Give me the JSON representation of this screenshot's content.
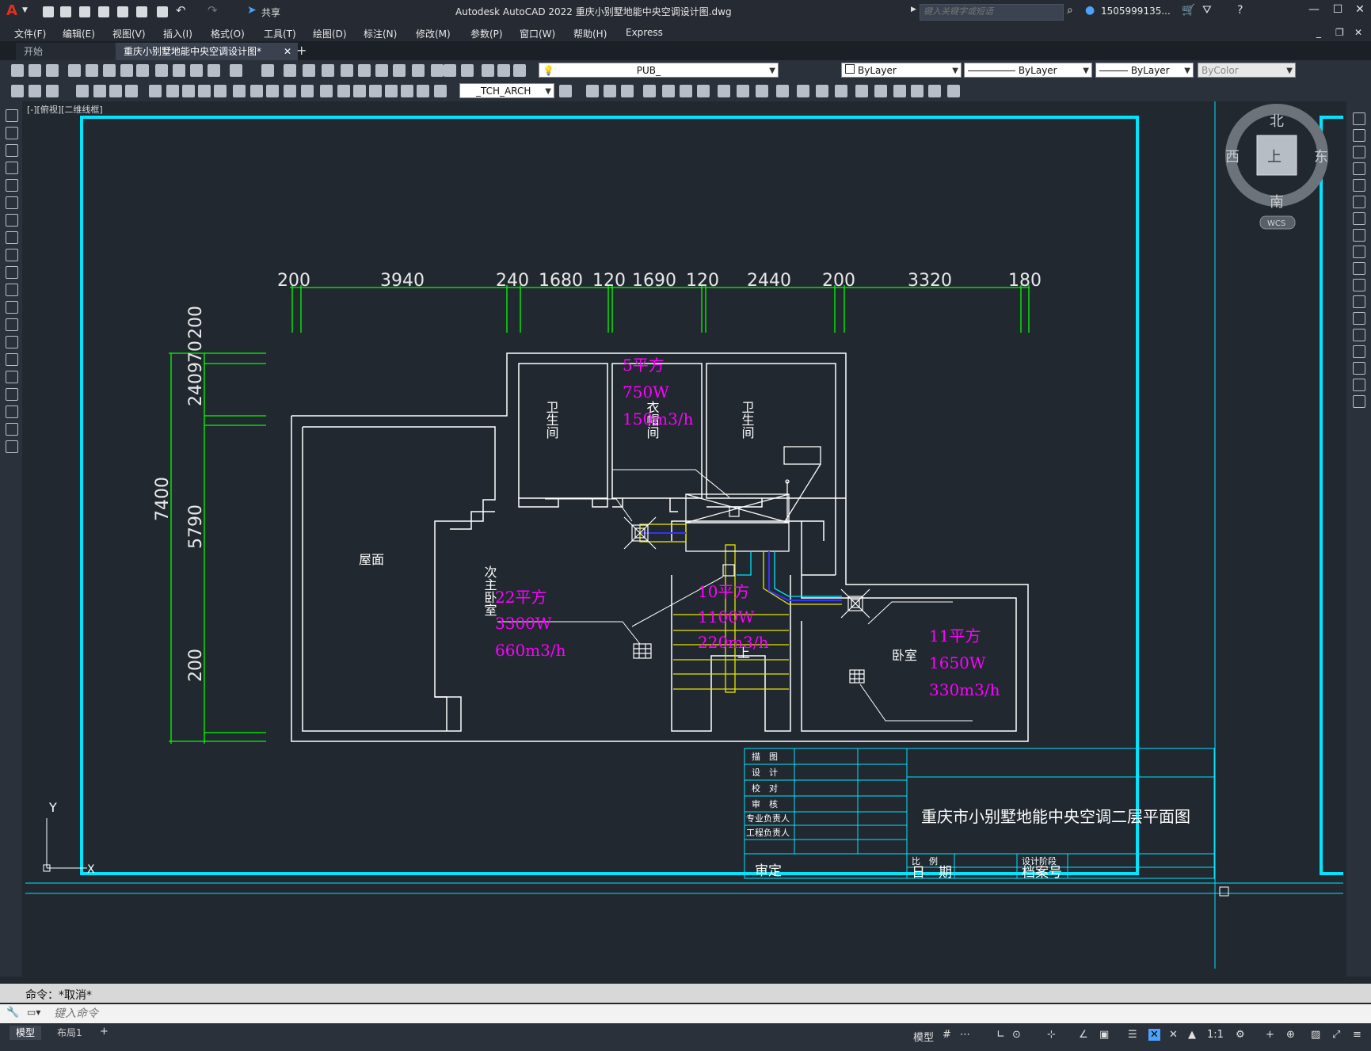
{
  "titlebar": {
    "share_label": "共享",
    "title": "Autodesk AutoCAD 2022    重庆小别墅地能中央空调设计图.dwg",
    "search_placeholder": "键入关键字或短语",
    "user": "1505999135...",
    "app_letter": "A"
  },
  "menu": [
    "文件(F)",
    "编辑(E)",
    "视图(V)",
    "插入(I)",
    "格式(O)",
    "工具(T)",
    "绘图(D)",
    "标注(N)",
    "修改(M)",
    "参数(P)",
    "窗口(W)",
    "帮助(H)",
    "Express"
  ],
  "tabs": {
    "start": "开始",
    "doc": "重庆小别墅地能中央空调设计图*"
  },
  "toolbar": {
    "layer": "PUB_",
    "color": "ByLayer",
    "linetype": "ByLayer",
    "lineweight": "ByLayer",
    "plotstyle": "ByColor",
    "textstyle": "_TCH_ARCH"
  },
  "canvas": {
    "viewport_label": "[-][俯视][二维线框]",
    "viewcube": {
      "north": "北",
      "south": "南",
      "west": "西",
      "east": "东",
      "top": "上",
      "wcs": "WCS"
    },
    "ucs": {
      "y": "Y",
      "x": "X"
    }
  },
  "drawing": {
    "dims_top": [
      "200",
      "3940",
      "240",
      "1680",
      "120",
      "1690",
      "120",
      "2440",
      "200",
      "3320",
      "180"
    ],
    "dims_left_total": "7400",
    "dims_left": [
      "5790",
      "2409",
      "70",
      "200",
      "200"
    ],
    "rooms": {
      "bath1": "卫生间",
      "closet": "衣帽间",
      "bath2": "卫生间",
      "roof": "屋面",
      "second_bedroom": "次主卧室",
      "bedroom": "卧室"
    },
    "loads": {
      "closet": [
        "5平方",
        "750W",
        "150m3/h"
      ],
      "second_bedroom": [
        "22平方",
        "3300W",
        "660m3/h"
      ],
      "hall": [
        "10平方",
        "1100W",
        "220m3/h"
      ],
      "bedroom": [
        "11平方",
        "1650W",
        "330m3/h"
      ]
    },
    "stair_label": "上"
  },
  "title_block": {
    "rows": [
      "描　图",
      "设　计",
      "校　对",
      "审　核",
      "专业负责人",
      "工程负责人"
    ],
    "approve": "审定",
    "project": "重庆市小别墅地能中央空调二层平面图",
    "scale": "比　例",
    "stage": "设计阶段",
    "date": "日　期",
    "archive": "档案号"
  },
  "command": {
    "history": "命令：*取消*",
    "placeholder": "键入命令"
  },
  "status": {
    "layout_model": "模型",
    "layout1": "布局1",
    "model_btn": "模型",
    "scale": "1:1"
  },
  "colors": {
    "magenta": "#ff00ff",
    "cyan": "#00e5ff",
    "green": "#00ff00",
    "yellow": "#e6e600",
    "white": "#ffffff"
  }
}
